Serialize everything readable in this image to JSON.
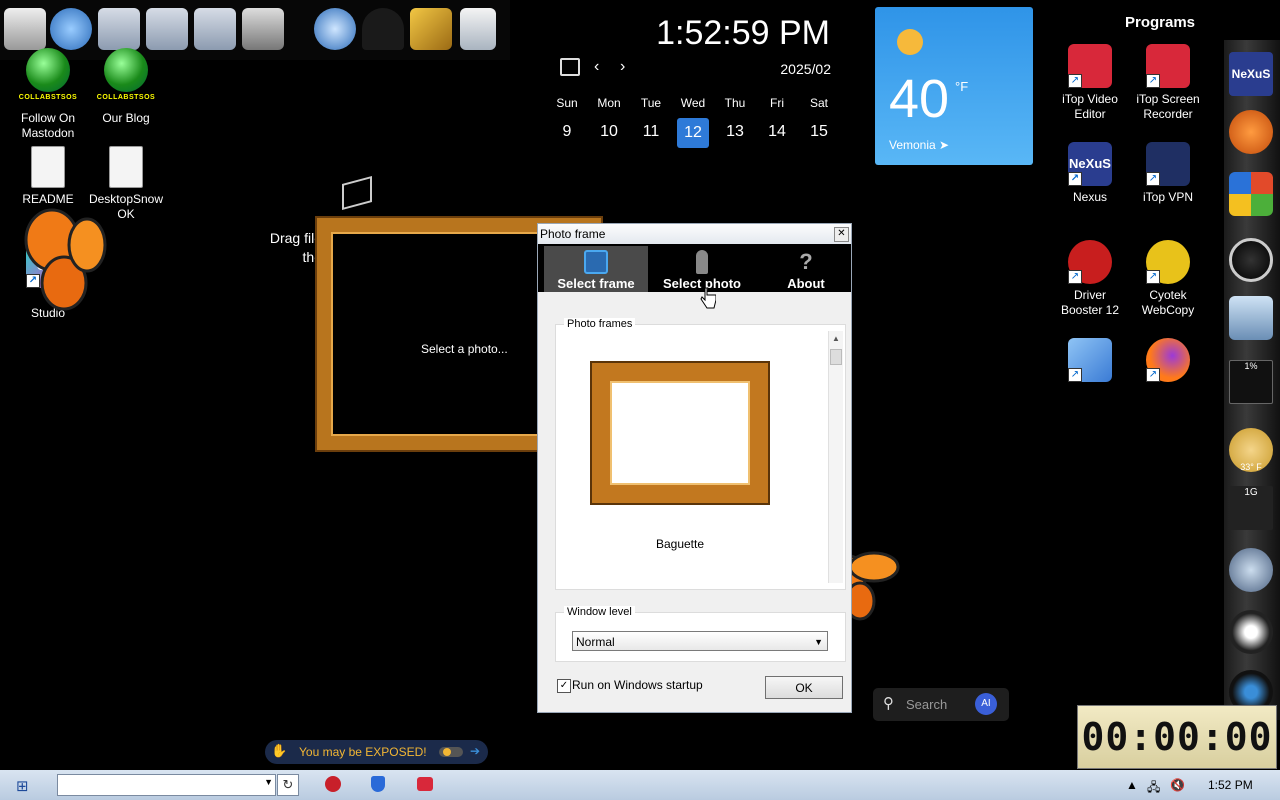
{
  "desktop": {
    "icons": [
      {
        "label": "Follow On\nMastodon",
        "badge": "COLLABSTSOS",
        "kind": "globe"
      },
      {
        "label": "Our Blog",
        "badge": "COLLABSTSOS",
        "kind": "globe"
      },
      {
        "label": "README",
        "kind": "doc"
      },
      {
        "label": "DesktopSnow\nOK",
        "kind": "doc-gear"
      },
      {
        "label": "Studio",
        "kind": "ds",
        "glyph": "ds"
      }
    ],
    "drag_text": "Drag file the",
    "top_toolbar_icons": [
      "computer-icon",
      "globe-icon",
      "folder-icon",
      "folder-icon",
      "folder-icon",
      "folder-icon",
      "tools-icon",
      "globe-icon",
      "person-icon",
      "pickaxe-icon",
      "recycle-bin-icon"
    ]
  },
  "clock": {
    "time": "1:52:59 PM",
    "month": "2025/02",
    "weekdays": [
      "Sun",
      "Mon",
      "Tue",
      "Wed",
      "Thu",
      "Fri",
      "Sat"
    ],
    "days": [
      "9",
      "10",
      "11",
      "12",
      "13",
      "14",
      "15"
    ],
    "today": "12"
  },
  "weather": {
    "temp": "40",
    "unit": "°F",
    "location": "Vemonia"
  },
  "programs": {
    "title": "Programs",
    "items": [
      {
        "label": "iTop Video\nEditor",
        "color": "#d8283a"
      },
      {
        "label": "iTop Screen\nRecorder",
        "color": "#d8283a"
      },
      {
        "label": "Nexus",
        "color": "#2a3d8f",
        "glyph": "NeXuS"
      },
      {
        "label": "iTop VPN",
        "color": "#1f2f63"
      },
      {
        "label": "Driver\nBooster 12",
        "color": "#c81e1e"
      },
      {
        "label": "Cyotek\nWebCopy",
        "color": "#e8c21a"
      },
      {
        "label": "",
        "color": "#3a7bd5"
      },
      {
        "label": "",
        "color": "#ff7a1a"
      }
    ]
  },
  "sidebar_widget": {
    "cpu": "1%",
    "weather_temp": "33° F",
    "mem": "1G",
    "logo": "NeXuS"
  },
  "photo_frame_widget": {
    "placeholder": "Select a photo..."
  },
  "dialog": {
    "title": "Photo frame",
    "close_glyph": "✕",
    "tabs": [
      "Select frame",
      "Select photo",
      "About"
    ],
    "group_frames": "Photo frames",
    "frame_name": "Baguette",
    "group_level": "Window level",
    "level_value": "Normal",
    "startup_label": "Run on Windows startup",
    "startup_checked": "✓",
    "ok": "OK"
  },
  "search": {
    "placeholder": "Search",
    "ai": "AI"
  },
  "exposed": {
    "text": "You may be EXPOSED!"
  },
  "timer": {
    "value": "00:00:00"
  },
  "taskbar": {
    "time": "1:52 PM"
  }
}
